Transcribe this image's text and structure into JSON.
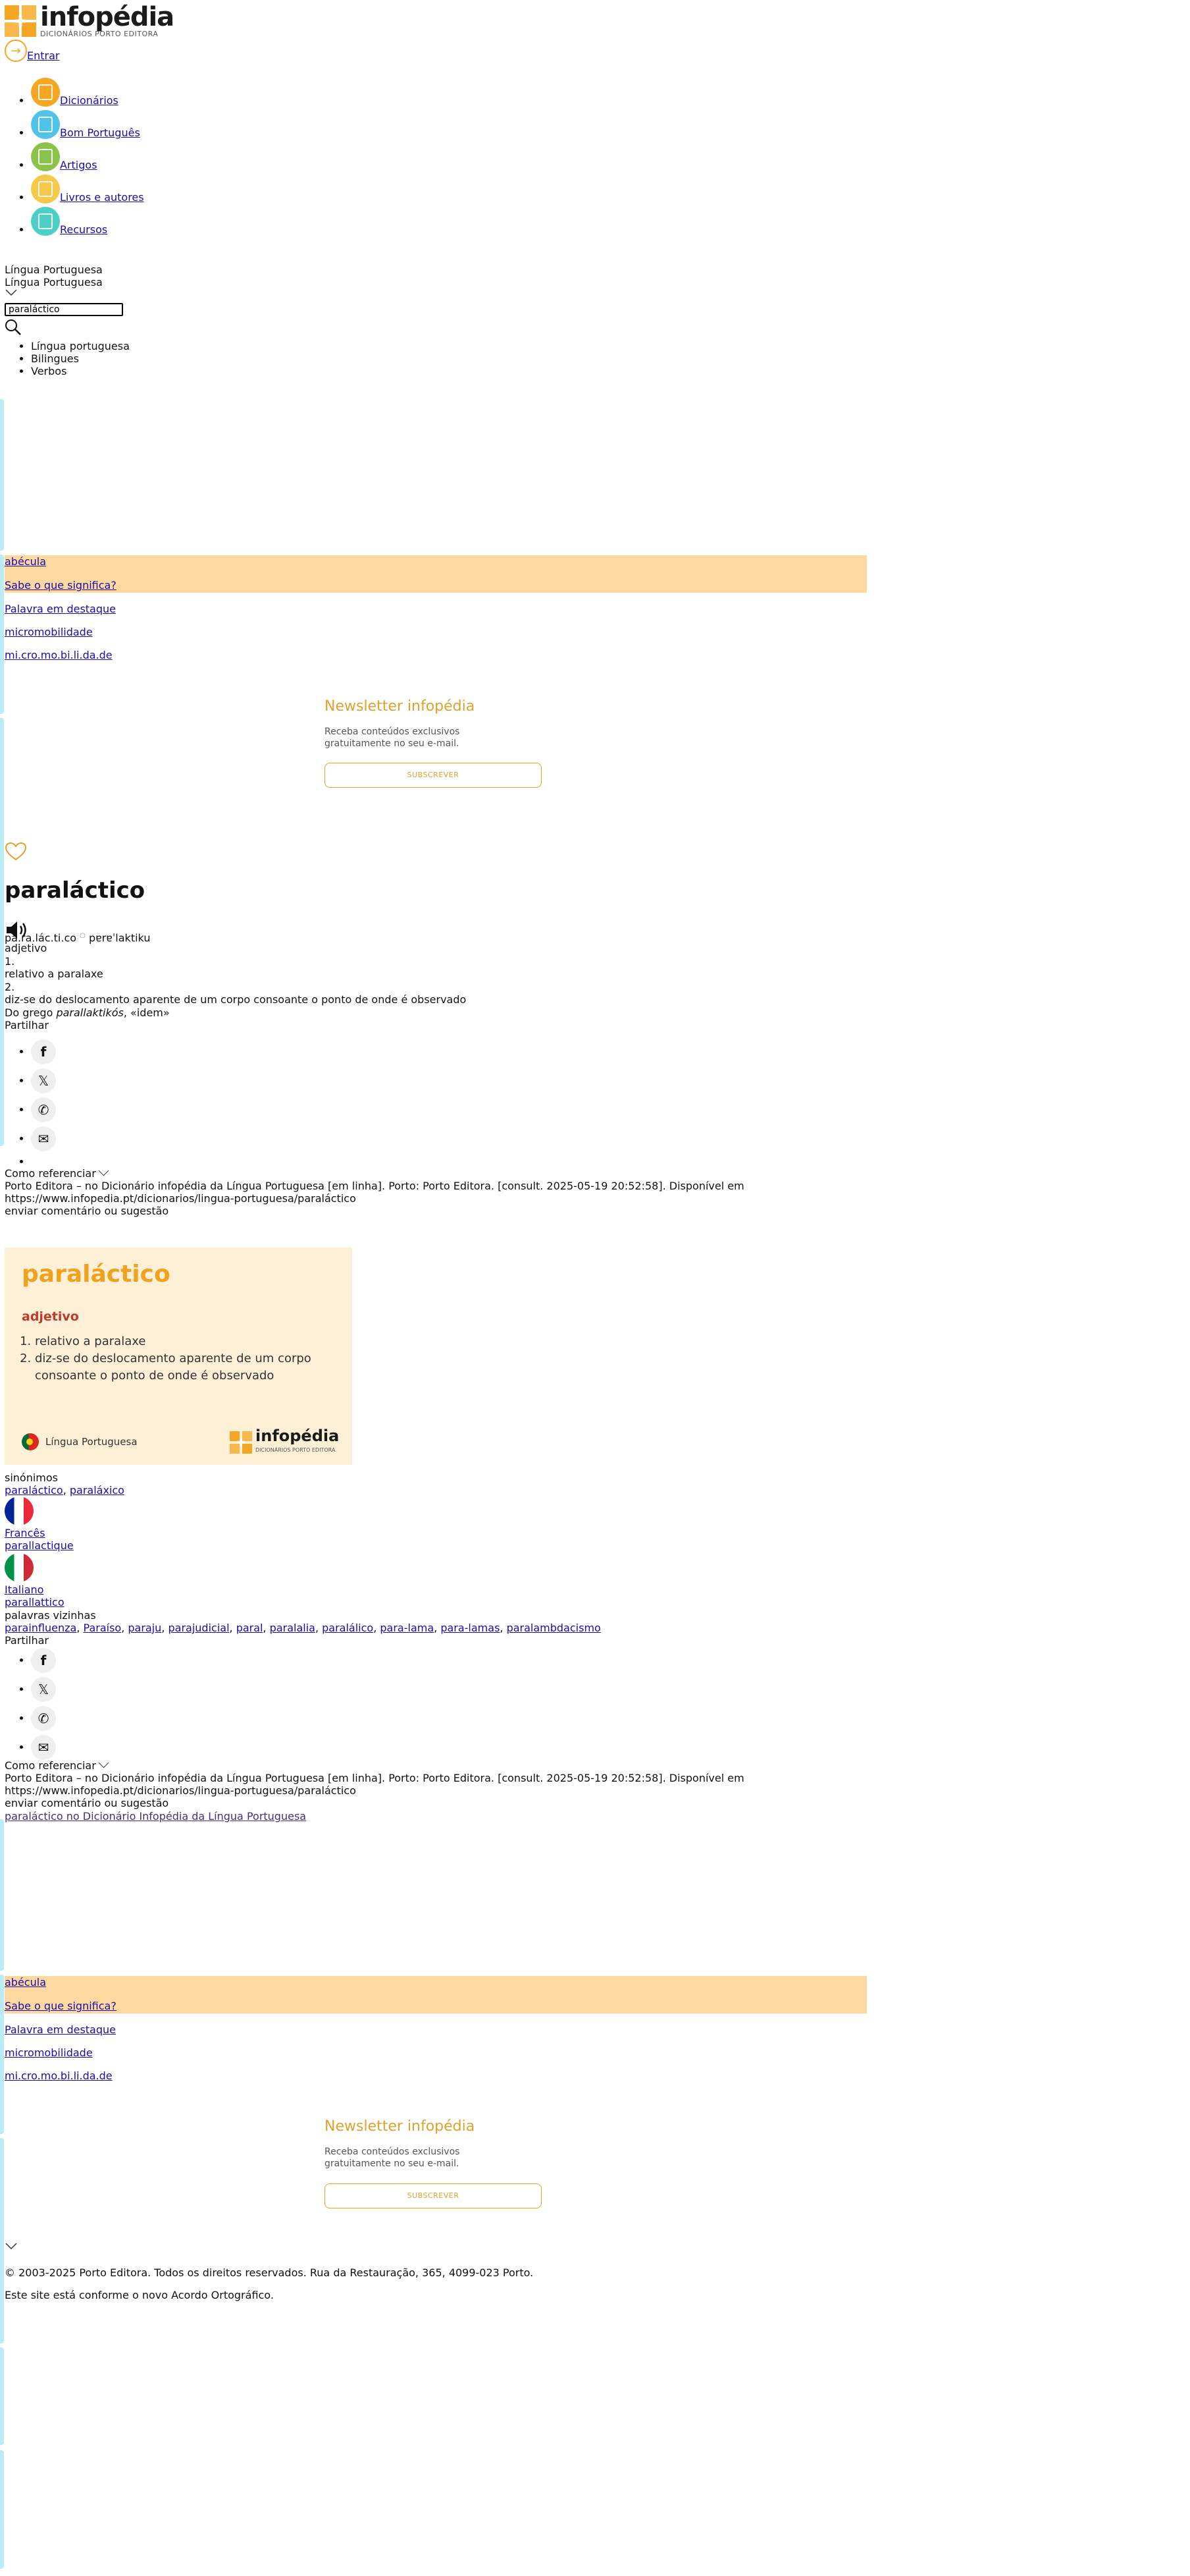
{
  "brand": {
    "name": "infopédia",
    "subtitle": "DICIONÁRIOS PORTO EDITORA"
  },
  "header": {
    "login_label": "Entrar"
  },
  "nav": {
    "items": [
      {
        "label": "Dicionários",
        "color": "#f5a623"
      },
      {
        "label": "Bom Português",
        "color": "#4fc3e8"
      },
      {
        "label": "Artigos",
        "color": "#8bc34a"
      },
      {
        "label": "Livros e autores",
        "color": "#f6c94a"
      },
      {
        "label": "Recursos",
        "color": "#4dd0c4"
      }
    ]
  },
  "dictionary_select": {
    "label": "Língua Portuguesa",
    "selected": "Língua Portuguesa"
  },
  "search": {
    "value": "paraláctico"
  },
  "search_categories": [
    "Língua portuguesa",
    "Bilingues",
    "Verbos"
  ],
  "highlights": {
    "word_of_day": "abécula",
    "word_of_day_cta": "Sabe o que significa?",
    "featured_label": "Palavra em destaque",
    "featured_word": "micromobilidade",
    "featured_syllables": "mi.cro.mo.bi.li.da.de"
  },
  "newsletter": {
    "title": "Newsletter infopédia",
    "text_line1": "Receba conteúdos exclusivos",
    "text_line2": "gratuitamente no seu e-mail.",
    "button": "SUBSCREVER"
  },
  "entry": {
    "word": "paraláctico",
    "syllables": "pa.ra.lác.ti.co",
    "pronunciation": "pɐrɐˈlaktiku",
    "pos": "adjetivo",
    "definitions": [
      {
        "num": "1.",
        "text": "relativo a paralaxe"
      },
      {
        "num": "2.",
        "text": "diz-se do deslocamento aparente de um corpo consoante o ponto de onde é observado"
      }
    ],
    "etymology_prefix": "Do grego ",
    "etymology_term": "parallaktikós",
    "etymology_suffix": ", «idem»"
  },
  "share": {
    "label": "Partilhar"
  },
  "citation": {
    "toggle": "Como referenciar",
    "text": "Porto Editora – no Dicionário infopédia da Língua Portuguesa [em linha]. Porto: Porto Editora. [consult. 2025-05-19 20:52:58]. Disponível em https://www.infopedia.pt/dicionarios/lingua-portuguesa/paraláctico",
    "feedback": "enviar comentário ou sugestão"
  },
  "card": {
    "word": "paraláctico",
    "pos": "adjetivo",
    "definitions": [
      "relativo a paralaxe",
      "diz-se do deslocamento aparente de um corpo consoante o ponto de onde é observado"
    ],
    "language": "Língua Portuguesa",
    "logo_word": "infopédia",
    "logo_sub": "DICIONÁRIOS PORTO EDITORA"
  },
  "synonyms": {
    "label": "sinónimos",
    "items": [
      "paraláctico",
      "paraláxico"
    ]
  },
  "translations": [
    {
      "language": "Francês",
      "word": "parallactique"
    },
    {
      "language": "Italiano",
      "word": "parallattico"
    }
  ],
  "neighbors": {
    "label": "palavras vizinhas",
    "items": [
      "parainfluenza",
      "Paraíso",
      "paraju",
      "parajudicial",
      "paral",
      "paralalia",
      "paralálico",
      "para-lama",
      "para-lamas",
      "paralambdacismo"
    ]
  },
  "image_link": "paraláctico no Dicionário Infopédia da Língua Portuguesa",
  "footer": {
    "copyright": "© 2003-2025 Porto Editora. Todos os direitos reservados. Rua da Restauração, 365, 4099-023 Porto.",
    "ortho_note": "Este site está conforme o novo Acordo Ortográfico."
  }
}
